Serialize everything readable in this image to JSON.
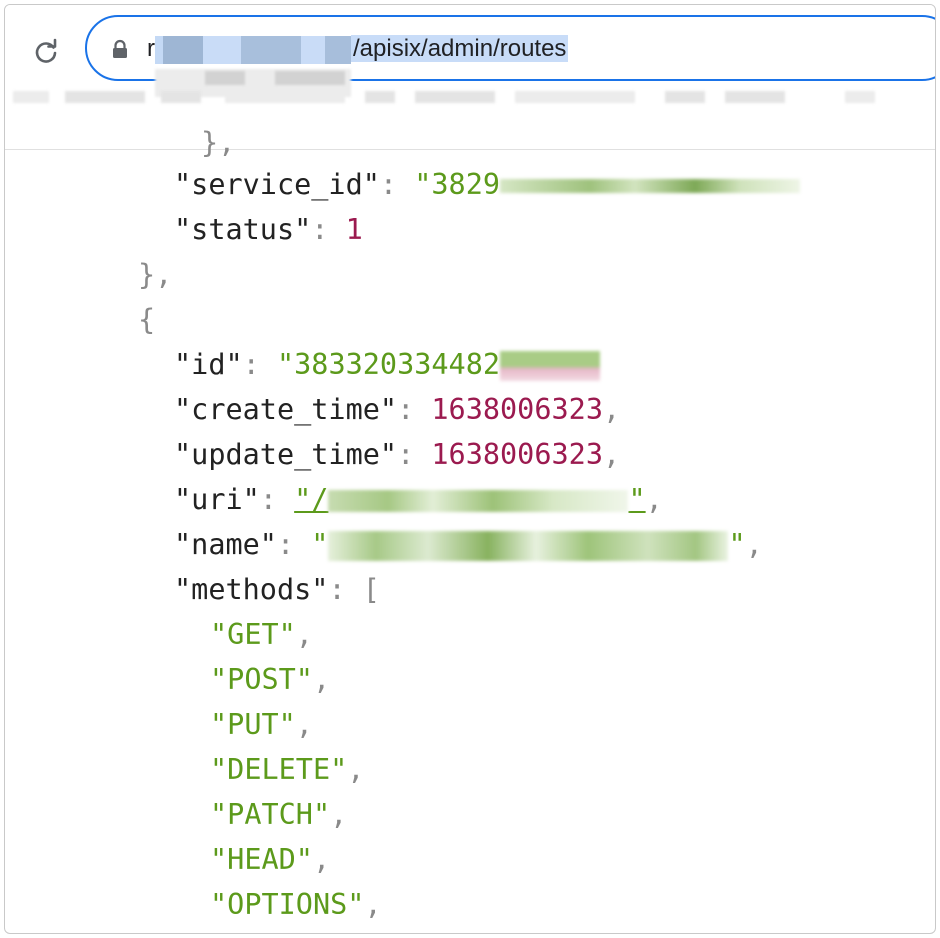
{
  "browser": {
    "url": {
      "host_visible": "r",
      "path": "/apisix/admin/routes"
    },
    "icons": {
      "reload": "reload-icon",
      "lock": "lock-icon"
    }
  },
  "json_view": {
    "service_id": {
      "key": "\"service_id\"",
      "value_prefix": "\"3829"
    },
    "status": {
      "key": "\"status\"",
      "value": "1"
    },
    "close_brace": "},",
    "open_brace": "{",
    "id": {
      "key": "\"id\"",
      "value_prefix": "\"383320334482"
    },
    "create_time": {
      "key": "\"create_time\"",
      "value": "1638006323"
    },
    "update_time": {
      "key": "\"update_time\"",
      "value": "1638006323"
    },
    "uri": {
      "key": "\"uri\"",
      "value_prefix": "\"/",
      "value_suffix": "\""
    },
    "name": {
      "key": "\"name\"",
      "value_prefix": "\"",
      "value_suffix": "\""
    },
    "methods": {
      "key": "\"methods\"",
      "open": "[",
      "items": [
        "\"GET\"",
        "\"POST\"",
        "\"PUT\"",
        "\"DELETE\"",
        "\"PATCH\"",
        "\"HEAD\"",
        "\"OPTIONS\""
      ]
    }
  },
  "colors": {
    "string": "#5c9a1b",
    "number": "#9b1a4f",
    "punct": "#8a8a8a",
    "focus_ring": "#1a73e8"
  }
}
